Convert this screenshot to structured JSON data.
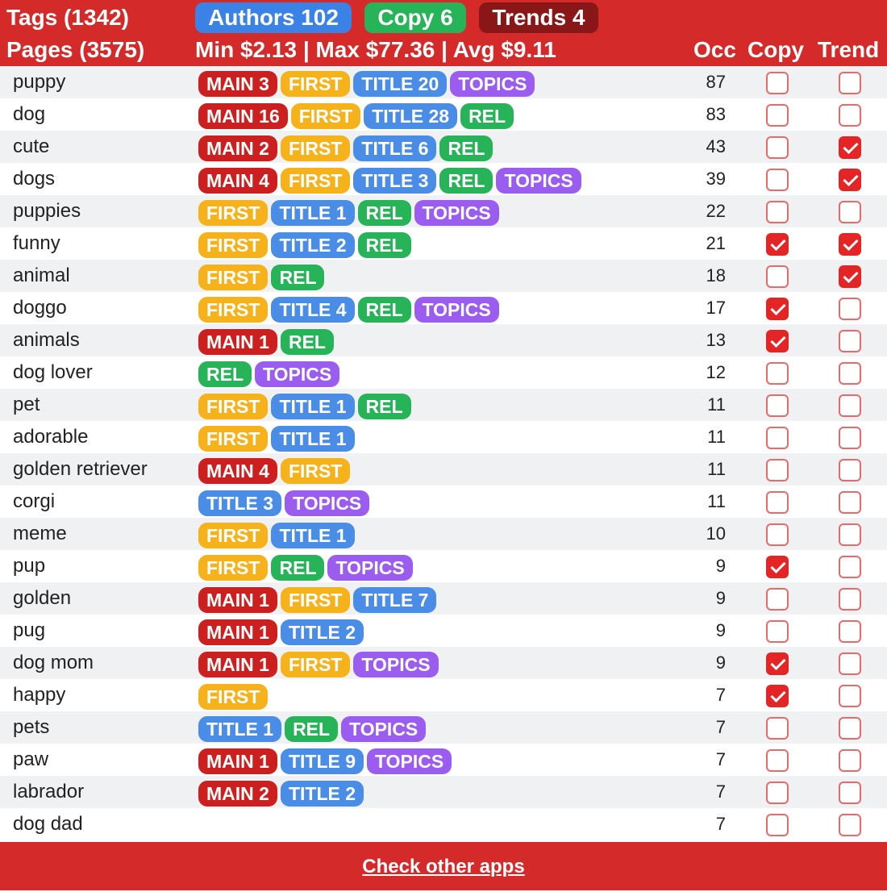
{
  "header": {
    "tags_label": "Tags (1342)",
    "pages_label": "Pages (3575)",
    "authors_pill": "Authors 102",
    "copy_pill": "Copy 6",
    "trends_pill": "Trends 4",
    "price_stats": "Min $2.13 | Max $77.36 | Avg $9.11",
    "col_occ": "Occ",
    "col_copy": "Copy",
    "col_trend": "Trend"
  },
  "colors": {
    "header_bg": "#d42a2a",
    "authors_pill": "#3b82e6",
    "copy_pill": "#27b357",
    "trends_pill": "#8a1717",
    "main": "#cc2020",
    "first": "#f6b21b",
    "title": "#4a8de6",
    "rel": "#27b357",
    "topics": "#9b5cf0"
  },
  "rows": [
    {
      "tag": "puppy",
      "badges": [
        {
          "type": "main",
          "label": "MAIN 3"
        },
        {
          "type": "first",
          "label": "FIRST"
        },
        {
          "type": "title",
          "label": "TITLE 20"
        },
        {
          "type": "topics",
          "label": "TOPICS"
        }
      ],
      "occ": "87",
      "copy": false,
      "trend": false
    },
    {
      "tag": "dog",
      "badges": [
        {
          "type": "main",
          "label": "MAIN 16"
        },
        {
          "type": "first",
          "label": "FIRST"
        },
        {
          "type": "title",
          "label": "TITLE 28"
        },
        {
          "type": "rel",
          "label": "REL"
        }
      ],
      "occ": "83",
      "copy": false,
      "trend": false
    },
    {
      "tag": "cute",
      "badges": [
        {
          "type": "main",
          "label": "MAIN 2"
        },
        {
          "type": "first",
          "label": "FIRST"
        },
        {
          "type": "title",
          "label": "TITLE 6"
        },
        {
          "type": "rel",
          "label": "REL"
        }
      ],
      "occ": "43",
      "copy": false,
      "trend": true
    },
    {
      "tag": "dogs",
      "badges": [
        {
          "type": "main",
          "label": "MAIN 4"
        },
        {
          "type": "first",
          "label": "FIRST"
        },
        {
          "type": "title",
          "label": "TITLE 3"
        },
        {
          "type": "rel",
          "label": "REL"
        },
        {
          "type": "topics",
          "label": "TOPICS"
        }
      ],
      "occ": "39",
      "copy": false,
      "trend": true
    },
    {
      "tag": "puppies",
      "badges": [
        {
          "type": "first",
          "label": "FIRST"
        },
        {
          "type": "title",
          "label": "TITLE 1"
        },
        {
          "type": "rel",
          "label": "REL"
        },
        {
          "type": "topics",
          "label": "TOPICS"
        }
      ],
      "occ": "22",
      "copy": false,
      "trend": false
    },
    {
      "tag": "funny",
      "badges": [
        {
          "type": "first",
          "label": "FIRST"
        },
        {
          "type": "title",
          "label": "TITLE 2"
        },
        {
          "type": "rel",
          "label": "REL"
        }
      ],
      "occ": "21",
      "copy": true,
      "trend": true
    },
    {
      "tag": "animal",
      "badges": [
        {
          "type": "first",
          "label": "FIRST"
        },
        {
          "type": "rel",
          "label": "REL"
        }
      ],
      "occ": "18",
      "copy": false,
      "trend": true
    },
    {
      "tag": "doggo",
      "badges": [
        {
          "type": "first",
          "label": "FIRST"
        },
        {
          "type": "title",
          "label": "TITLE 4"
        },
        {
          "type": "rel",
          "label": "REL"
        },
        {
          "type": "topics",
          "label": "TOPICS"
        }
      ],
      "occ": "17",
      "copy": true,
      "trend": false
    },
    {
      "tag": "animals",
      "badges": [
        {
          "type": "main",
          "label": "MAIN 1"
        },
        {
          "type": "rel",
          "label": "REL"
        }
      ],
      "occ": "13",
      "copy": true,
      "trend": false
    },
    {
      "tag": "dog lover",
      "badges": [
        {
          "type": "rel",
          "label": "REL"
        },
        {
          "type": "topics",
          "label": "TOPICS"
        }
      ],
      "occ": "12",
      "copy": false,
      "trend": false
    },
    {
      "tag": "pet",
      "badges": [
        {
          "type": "first",
          "label": "FIRST"
        },
        {
          "type": "title",
          "label": "TITLE 1"
        },
        {
          "type": "rel",
          "label": "REL"
        }
      ],
      "occ": "11",
      "copy": false,
      "trend": false
    },
    {
      "tag": "adorable",
      "badges": [
        {
          "type": "first",
          "label": "FIRST"
        },
        {
          "type": "title",
          "label": "TITLE 1"
        }
      ],
      "occ": "11",
      "copy": false,
      "trend": false
    },
    {
      "tag": "golden retriever",
      "badges": [
        {
          "type": "main",
          "label": "MAIN 4"
        },
        {
          "type": "first",
          "label": "FIRST"
        }
      ],
      "occ": "11",
      "copy": false,
      "trend": false
    },
    {
      "tag": "corgi",
      "badges": [
        {
          "type": "title",
          "label": "TITLE 3"
        },
        {
          "type": "topics",
          "label": "TOPICS"
        }
      ],
      "occ": "11",
      "copy": false,
      "trend": false
    },
    {
      "tag": "meme",
      "badges": [
        {
          "type": "first",
          "label": "FIRST"
        },
        {
          "type": "title",
          "label": "TITLE 1"
        }
      ],
      "occ": "10",
      "copy": false,
      "trend": false
    },
    {
      "tag": "pup",
      "badges": [
        {
          "type": "first",
          "label": "FIRST"
        },
        {
          "type": "rel",
          "label": "REL"
        },
        {
          "type": "topics",
          "label": "TOPICS"
        }
      ],
      "occ": "9",
      "copy": true,
      "trend": false
    },
    {
      "tag": "golden",
      "badges": [
        {
          "type": "main",
          "label": "MAIN 1"
        },
        {
          "type": "first",
          "label": "FIRST"
        },
        {
          "type": "title",
          "label": "TITLE 7"
        }
      ],
      "occ": "9",
      "copy": false,
      "trend": false
    },
    {
      "tag": "pug",
      "badges": [
        {
          "type": "main",
          "label": "MAIN 1"
        },
        {
          "type": "title",
          "label": "TITLE 2"
        }
      ],
      "occ": "9",
      "copy": false,
      "trend": false
    },
    {
      "tag": "dog mom",
      "badges": [
        {
          "type": "main",
          "label": "MAIN 1"
        },
        {
          "type": "first",
          "label": "FIRST"
        },
        {
          "type": "topics",
          "label": "TOPICS"
        }
      ],
      "occ": "9",
      "copy": true,
      "trend": false
    },
    {
      "tag": "happy",
      "badges": [
        {
          "type": "first",
          "label": "FIRST"
        }
      ],
      "occ": "7",
      "copy": true,
      "trend": false
    },
    {
      "tag": "pets",
      "badges": [
        {
          "type": "title",
          "label": "TITLE 1"
        },
        {
          "type": "rel",
          "label": "REL"
        },
        {
          "type": "topics",
          "label": "TOPICS"
        }
      ],
      "occ": "7",
      "copy": false,
      "trend": false
    },
    {
      "tag": "paw",
      "badges": [
        {
          "type": "main",
          "label": "MAIN 1"
        },
        {
          "type": "title",
          "label": "TITLE 9"
        },
        {
          "type": "topics",
          "label": "TOPICS"
        }
      ],
      "occ": "7",
      "copy": false,
      "trend": false
    },
    {
      "tag": "labrador",
      "badges": [
        {
          "type": "main",
          "label": "MAIN 2"
        },
        {
          "type": "title",
          "label": "TITLE 2"
        }
      ],
      "occ": "7",
      "copy": false,
      "trend": false
    },
    {
      "tag": "dog dad",
      "badges": [],
      "occ": "7",
      "copy": false,
      "trend": false
    }
  ],
  "footer": {
    "link_text": "Check other apps"
  }
}
